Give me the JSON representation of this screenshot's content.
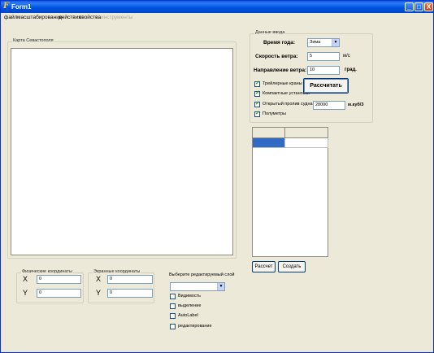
{
  "window": {
    "title": "Form1",
    "controls": {
      "minimize": "_",
      "maximize": "□",
      "close": "X"
    }
  },
  "menu": [
    {
      "label": "файл",
      "disabled": false
    },
    {
      "label": "масштабирование",
      "disabled": false
    },
    {
      "label": "действия",
      "disabled": false
    },
    {
      "label": "свойства",
      "disabled": false
    },
    {
      "label": "инструменты",
      "disabled": true
    }
  ],
  "map_group": {
    "legend": "Карта Севастополя"
  },
  "input_group": {
    "legend": "Данные ввода",
    "season": {
      "label": "Время года:",
      "value": "Зима"
    },
    "wind_speed": {
      "label": "Скорость ветра:",
      "value": "5",
      "unit": "м/с"
    },
    "wind_direction": {
      "label": "Направление ветра:",
      "value": "10",
      "unit": "град."
    },
    "checkboxes": [
      {
        "label": "Трейлерные краны",
        "checked": true
      },
      {
        "label": "Компактные установки",
        "checked": true
      },
      {
        "label": "Открытый пролив судна",
        "checked": true
      },
      {
        "label": "Полуметры",
        "checked": true
      }
    ],
    "volume": {
      "value": "28000",
      "unit": "м.куб/3"
    },
    "calculate_button": "Рассчитать"
  },
  "result_table": {
    "columns": [
      "",
      ""
    ],
    "rows": [
      [
        "",
        ""
      ]
    ]
  },
  "buttons": {
    "calc": "Рассчет",
    "clear": "Создать"
  },
  "physical_coords": {
    "legend": "Физические координаты",
    "x_label": "X",
    "y_label": "Y",
    "x": "0",
    "y": "0"
  },
  "screen_coords": {
    "legend": "Экранные координаты",
    "x_label": "X",
    "y_label": "Y",
    "x": "0",
    "y": "0"
  },
  "layers": {
    "label": "Выберите редактируемый слой",
    "selected": "",
    "checkboxes": [
      {
        "label": "Видимость",
        "checked": false
      },
      {
        "label": "выделение",
        "checked": false
      },
      {
        "label": "AutoLabel",
        "checked": false
      },
      {
        "label": "редактирование",
        "checked": false
      }
    ]
  },
  "colors": {
    "title_bar": "#0054e3",
    "selection": "#316ac5",
    "window_bg": "#ece9d8"
  }
}
